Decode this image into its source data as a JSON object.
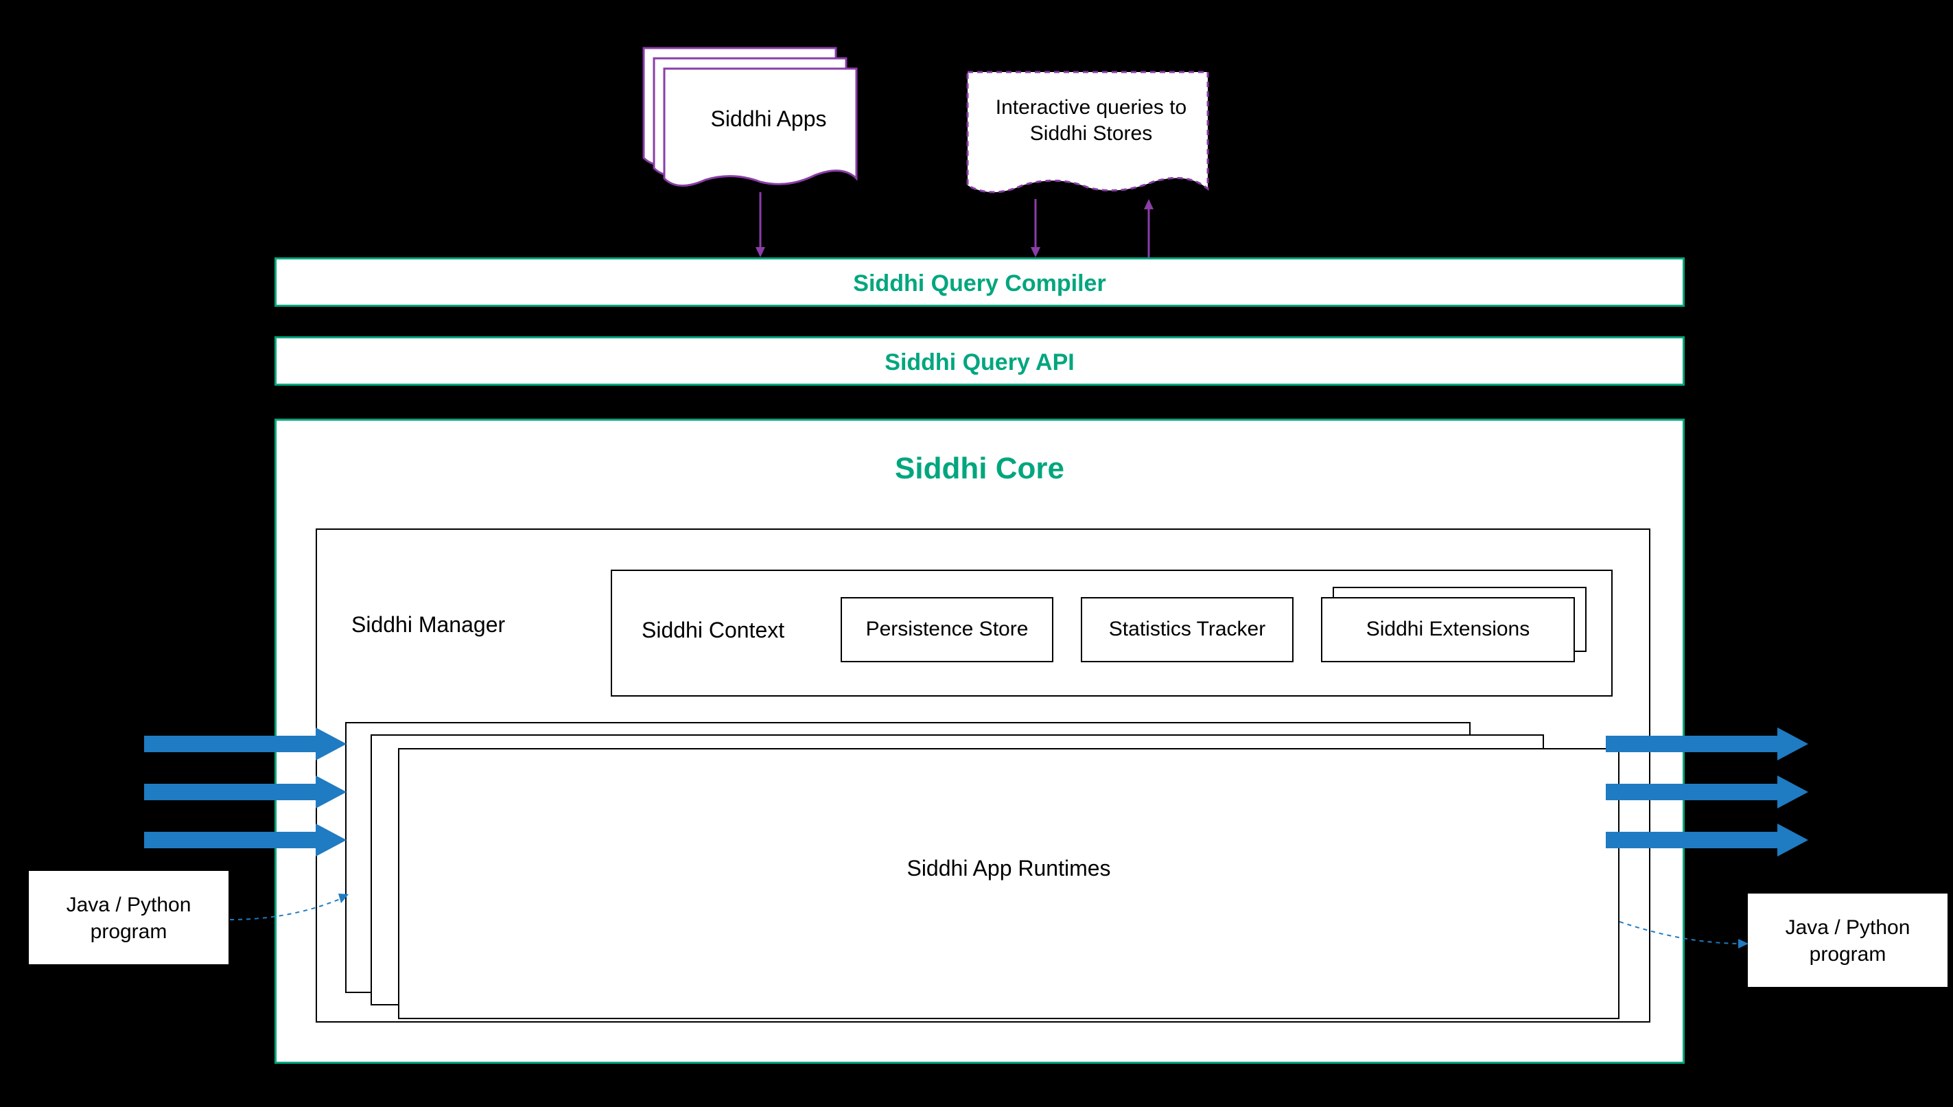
{
  "colors": {
    "teal": "#00a67e",
    "purple": "#8b3da8",
    "blue": "#1f7bc2",
    "black": "#000000",
    "white": "#ffffff"
  },
  "top": {
    "siddhi_apps": "Siddhi Apps",
    "interactive_queries_line1": "Interactive queries to",
    "interactive_queries_line2": "Siddhi Stores"
  },
  "bars": {
    "compiler": "Siddhi Query Compiler",
    "api": "Siddhi Query API"
  },
  "core": {
    "title": "Siddhi Core",
    "manager": "Siddhi Manager",
    "context": "Siddhi Context",
    "persistence": "Persistence Store",
    "statistics": "Statistics Tracker",
    "extensions": "Siddhi Extensions",
    "runtimes": "Siddhi App Runtimes"
  },
  "external": {
    "java_python_left_line1": "Java / Python",
    "java_python_left_line2": "program",
    "java_python_right_line1": "Java / Python",
    "java_python_right_line2": "program"
  }
}
